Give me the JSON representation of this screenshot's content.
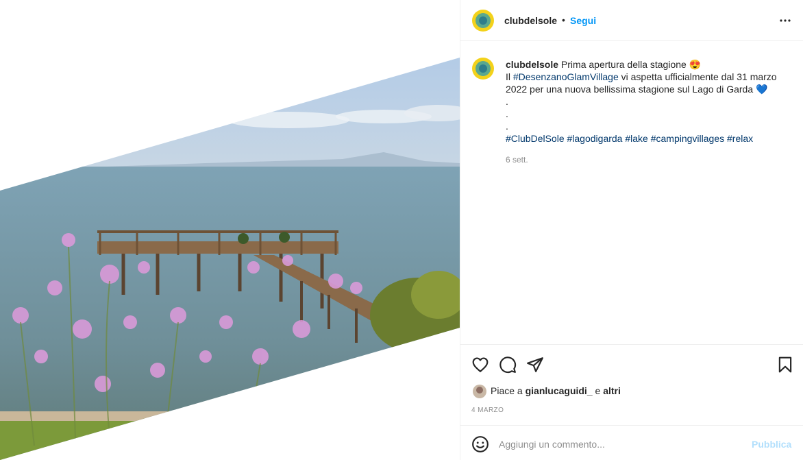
{
  "post": {
    "username": "clubdelsole",
    "dot": "•",
    "follow_label": "Segui",
    "more_icon": "more-horizontal-icon"
  },
  "caption": {
    "username": "clubdelsole",
    "line1_text": "Prima apertura della stagione 😍",
    "line2_prefix": "Il ",
    "line2_tag": "#DesenzanoGlamVillage",
    "line2_rest": " vi aspetta ufficialmente dal 31 marzo",
    "line3": "2022 per una nuova bellissima stagione sul Lago di Garda 💙",
    "dots": [
      ".",
      ".",
      "."
    ],
    "hashtags": [
      "#ClubDelSole",
      "#lagodigarda",
      "#lake",
      "#campingvillages",
      "#relax"
    ],
    "timestamp": "6 sett."
  },
  "actions": {
    "like_icon": "heart-icon",
    "comment_icon": "comment-icon",
    "share_icon": "paper-plane-icon",
    "save_icon": "bookmark-icon"
  },
  "likes": {
    "prefix": "Piace a ",
    "user": "gianlucaguidi_",
    "middle": " e ",
    "others": "altri"
  },
  "date": "4 MARZO",
  "comment": {
    "placeholder": "Aggiungi un commento...",
    "publish_label": "Pubblica",
    "emoji_icon": "smiley-icon"
  },
  "colors": {
    "link_blue": "#0095f6",
    "hashtag": "#00376b",
    "muted": "#8e8e8e",
    "publish_disabled": "#b2dffc"
  }
}
